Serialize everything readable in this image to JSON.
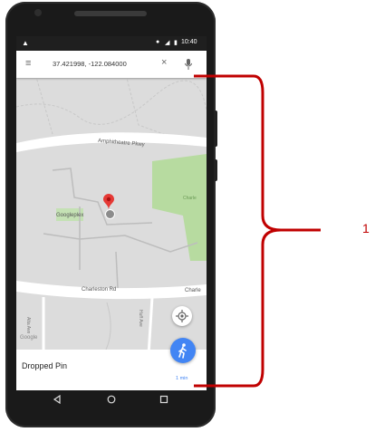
{
  "status_bar": {
    "time": "10:40"
  },
  "search": {
    "query": "37.421998, -122.084000"
  },
  "map": {
    "roads": {
      "top": "Amphitheatre Pkwy",
      "bottom": "Charleston Rd",
      "bottom_right": "Charle",
      "left_vertical": "Alta Ave",
      "right_vertical": "Huff Ave"
    },
    "place": "Googleplex",
    "park_label": "Charle",
    "attribution": "Google"
  },
  "card": {
    "title": "Dropped Pin",
    "eta": "1 min"
  },
  "annotation": {
    "number": "1"
  },
  "colors": {
    "accent": "#4285f4",
    "bracket": "#c00000",
    "park": "#b7dba0",
    "pin": "#e53935"
  }
}
